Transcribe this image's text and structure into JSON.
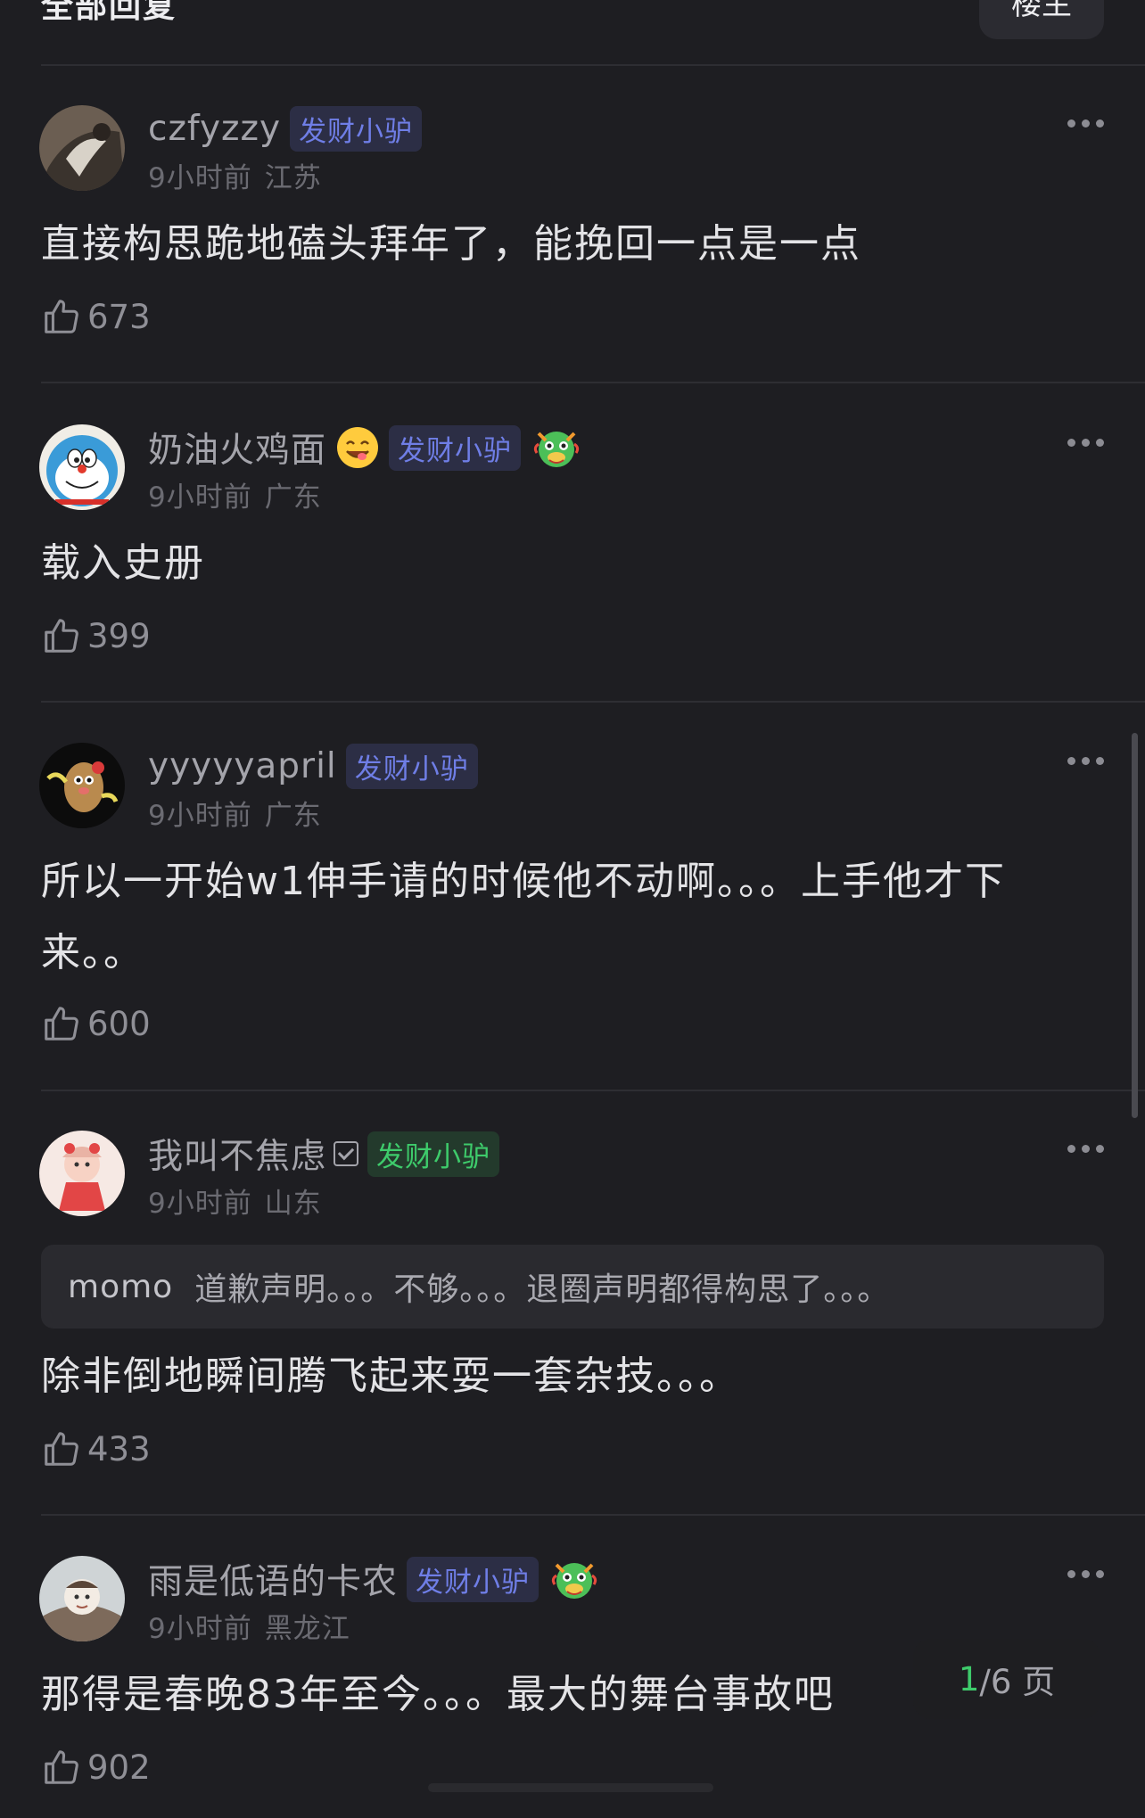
{
  "header": {
    "title": "全部回复",
    "button": "楼主"
  },
  "comments": [
    {
      "username": "czfyzzy",
      "badge": "发财小驴",
      "time": "9小时前",
      "location": "江苏",
      "content": "直接构思跪地磕头拜年了，能挽回一点是一点",
      "likes": "673"
    },
    {
      "username": "奶油火鸡面",
      "badge": "发财小驴",
      "time": "9小时前",
      "location": "广东",
      "content": "载入史册",
      "likes": "399"
    },
    {
      "username": "yyyyyapril",
      "badge": "发财小驴",
      "time": "9小时前",
      "location": "广东",
      "content": "所以一开始w1伸手请的时候他不动啊。。。上手他才下来。。",
      "likes": "600"
    },
    {
      "username": "我叫不焦虑",
      "badge": "发财小驴",
      "time": "9小时前",
      "location": "山东",
      "quote_user": "momo",
      "quote_text": "道歉声明。。。不够。。。退圈声明都得构思了。。。",
      "content": "除非倒地瞬间腾飞起来耍一套杂技。。。",
      "likes": "433"
    },
    {
      "username": "雨是低语的卡农",
      "badge": "发财小驴",
      "time": "9小时前",
      "location": "黑龙江",
      "content": "那得是春晚83年至今。。。最大的舞台事故吧",
      "likes": "902"
    }
  ],
  "pager": {
    "current": "1",
    "total_label": "/6 页"
  },
  "icons": {
    "like": "thumbs-up-icon",
    "more": "more-dots-icon",
    "emoji_yum": "yum-face-emoji",
    "dragon": "dragon-emoji",
    "verified": "verified-check-icon"
  },
  "colors": {
    "background": "#1e1e22",
    "badge_blue": "#6f7ee6",
    "badge_green": "#3ecb6b",
    "page_current": "#3ecb6b"
  }
}
